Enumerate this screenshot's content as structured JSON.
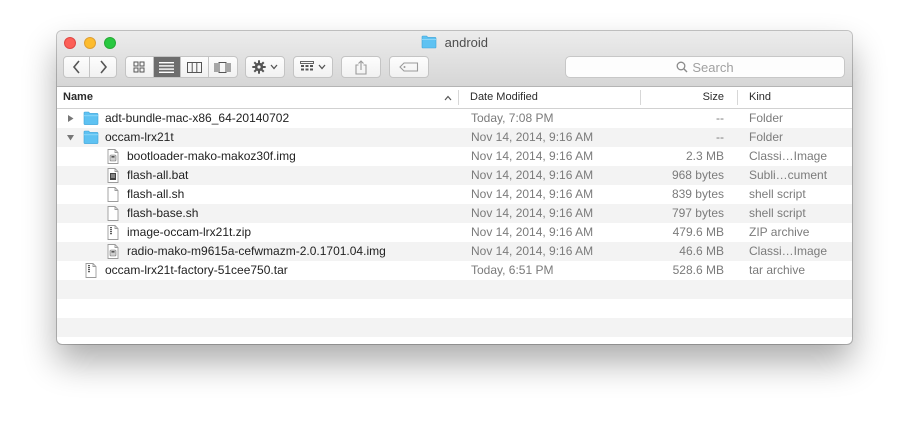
{
  "window": {
    "title": "android"
  },
  "toolbar": {
    "search_placeholder": "Search"
  },
  "columns": {
    "name": "Name",
    "date": "Date Modified",
    "size": "Size",
    "kind": "Kind"
  },
  "files": [
    {
      "name": "adt-bundle-mac-x86_64-20140702",
      "date": "Today, 7:08 PM",
      "size": "--",
      "kind": "Folder",
      "type": "folder",
      "level": 0,
      "disclosure": "collapsed"
    },
    {
      "name": "occam-lrx21t",
      "date": "Nov 14, 2014, 9:16 AM",
      "size": "--",
      "kind": "Folder",
      "type": "folder",
      "level": 0,
      "disclosure": "expanded"
    },
    {
      "name": "bootloader-mako-makoz30f.img",
      "date": "Nov 14, 2014, 9:16 AM",
      "size": "2.3 MB",
      "kind": "Classi…Image",
      "type": "image-file",
      "level": 1
    },
    {
      "name": "flash-all.bat",
      "date": "Nov 14, 2014, 9:16 AM",
      "size": "968 bytes",
      "kind": "Subli…cument",
      "type": "text-file",
      "level": 1
    },
    {
      "name": "flash-all.sh",
      "date": "Nov 14, 2014, 9:16 AM",
      "size": "839 bytes",
      "kind": "shell script",
      "type": "blank-file",
      "level": 1
    },
    {
      "name": "flash-base.sh",
      "date": "Nov 14, 2014, 9:16 AM",
      "size": "797 bytes",
      "kind": "shell script",
      "type": "blank-file",
      "level": 1
    },
    {
      "name": "image-occam-lrx21t.zip",
      "date": "Nov 14, 2014, 9:16 AM",
      "size": "479.6 MB",
      "kind": "ZIP archive",
      "type": "archive-file",
      "level": 1
    },
    {
      "name": "radio-mako-m9615a-cefwmazm-2.0.1701.04.img",
      "date": "Nov 14, 2014, 9:16 AM",
      "size": "46.6 MB",
      "kind": "Classi…Image",
      "type": "image-file",
      "level": 1
    },
    {
      "name": "occam-lrx21t-factory-51cee750.tar",
      "date": "Today, 6:51 PM",
      "size": "528.6 MB",
      "kind": "tar archive",
      "type": "archive-file",
      "level": 0
    }
  ],
  "empty_rows": 3,
  "colors": {
    "folder": "#5ec2f2",
    "close": "#fc5f57",
    "minimize": "#fdbc2e",
    "zoom": "#28c840",
    "alt_row": "#f3f3f3"
  },
  "icons": {
    "back": "chevron-left-icon",
    "forward": "chevron-right-icon",
    "views": [
      "icon-view-icon",
      "list-view-icon",
      "column-view-icon",
      "cover-flow-icon"
    ],
    "action": "gear-icon",
    "arrange": "arrange-grid-icon",
    "share": "share-icon",
    "tags": "tag-icon",
    "search": "search-icon"
  }
}
